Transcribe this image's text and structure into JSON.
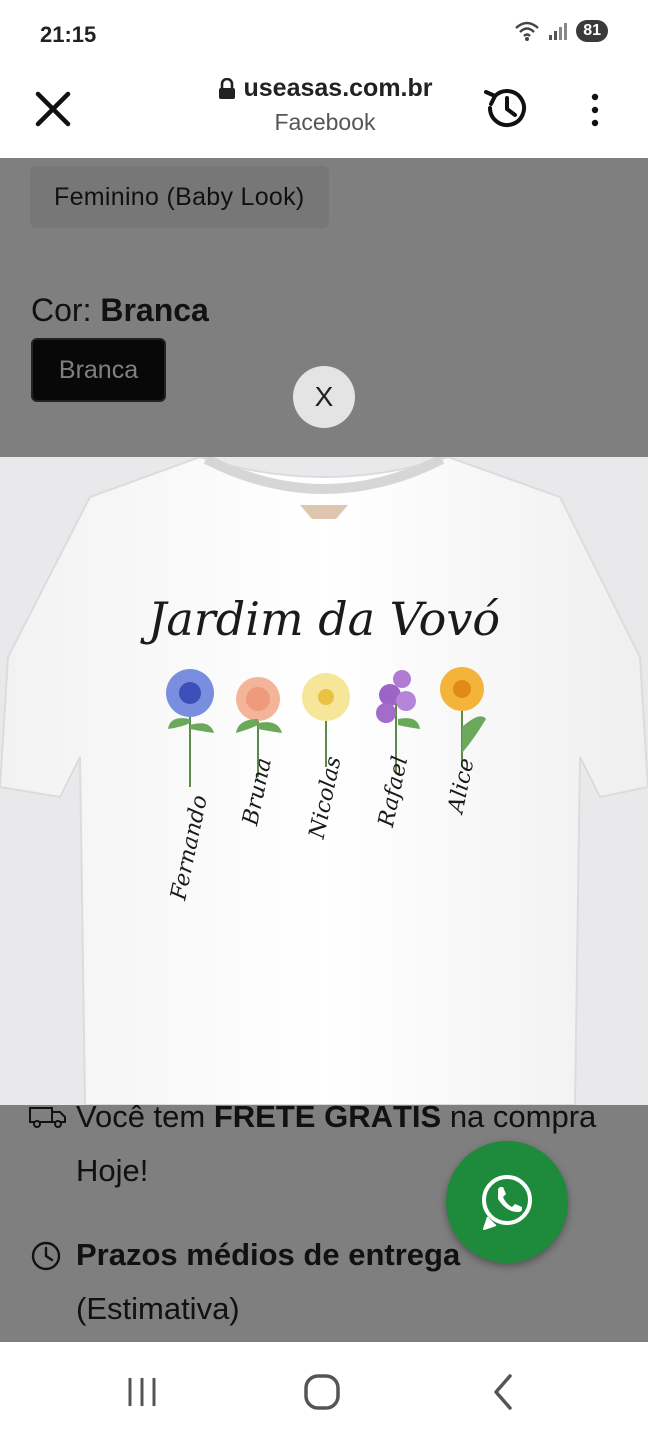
{
  "status": {
    "time": "21:15",
    "battery": "81"
  },
  "toolbar": {
    "url": "useasas.com.br",
    "source": "Facebook"
  },
  "product": {
    "size_option": "Feminino (Baby Look)",
    "color_prefix": "Cor:",
    "color_value": "Branca",
    "color_chip": "Branca"
  },
  "shipping": {
    "line1_a": "Você tem ",
    "line1_b": "FRETE GRÁTIS",
    "line1_c": " na compra Hoje!",
    "deadline_bold": "Prazos médios de entrega",
    "deadline_sub": "(Estimativa)"
  },
  "popup": {
    "close_label": "X",
    "design_title": "Jardim da Vovó",
    "names": [
      "Fernando",
      "Bruna",
      "Nicolas",
      "Rafael",
      "Alice"
    ]
  },
  "colors": {
    "whatsapp": "#1e8a3b",
    "overlay": "rgba(0,0,0,0.5)"
  }
}
